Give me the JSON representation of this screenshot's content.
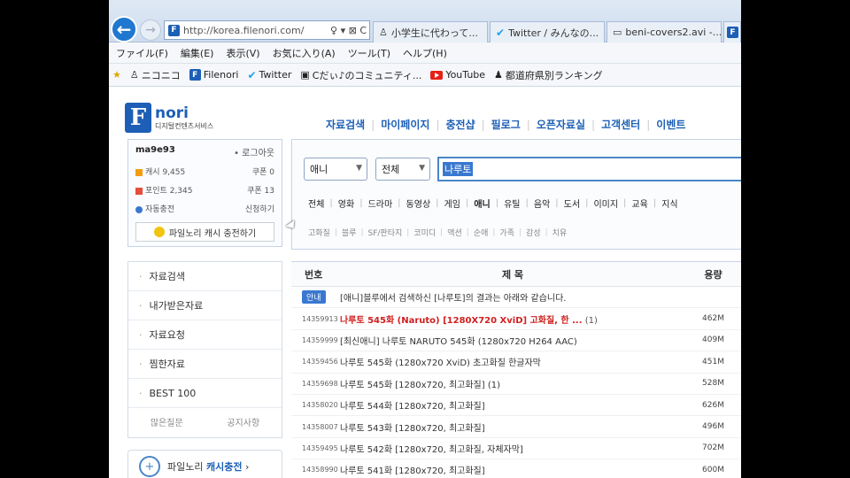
{
  "browser": {
    "address_url": "http://korea.filenori.com/",
    "address_controls": "♀ ▾ ⊠ C",
    "tabs": [
      {
        "label": "小学生に代わって..."
      },
      {
        "label": "Twitter / みんなの..."
      },
      {
        "label": "beni-covers2.avi -..."
      },
      {
        "label": ""
      }
    ],
    "menu": [
      "ファイル(F)",
      "編集(E)",
      "表示(V)",
      "お気に入り(A)",
      "ツール(T)",
      "ヘルプ(H)"
    ],
    "favorites": [
      "ニコニコ",
      "Filenori",
      "Twitter",
      "Cだぃ♪のコミュニティ...",
      "YouTube",
      "都道府県別ランキング"
    ]
  },
  "site": {
    "logo_brand": "nori",
    "logo_subtitle": "디지털컨텐츠서비스",
    "topnav": [
      "자료검색",
      "마이페이지",
      "충전샵",
      "필로그",
      "오픈자료실",
      "고객센터",
      "이벤트"
    ]
  },
  "login": {
    "user_id": "ma9e93",
    "logout": "• 로그아웃",
    "stats": [
      {
        "label": "캐시",
        "value": "9,455",
        "label2": "쿠폰",
        "value2": "0"
      },
      {
        "label": "포인트",
        "value": "2,345",
        "label2": "쿠폰",
        "value2": "13"
      }
    ],
    "auto_label": "자동충전",
    "auto_value": "신청하기",
    "cash_button": "파일노리 캐시 충전하기"
  },
  "search": {
    "category_select": "애니",
    "scope_select": "전체",
    "query": "나루토",
    "categories": [
      "전체",
      "영화",
      "드라마",
      "동영상",
      "게임",
      "애니",
      "유틸",
      "음악",
      "도서",
      "이미지",
      "교육",
      "지식"
    ],
    "active_category": "애니",
    "subcategories": [
      "고화질",
      "블루",
      "SF/판타지",
      "코미디",
      "액션",
      "순애",
      "가족",
      "감성",
      "치유"
    ]
  },
  "sidebar": {
    "items": [
      "자료검색",
      "내가받은자료",
      "자료요청",
      "찜한자료",
      "BEST 100"
    ],
    "footer": [
      "많은질문",
      "공지사항"
    ],
    "charge_label": "파일노리 ",
    "charge_bold": "캐시충전"
  },
  "table": {
    "headers": {
      "num": "번호",
      "title": "제 목",
      "size": "용량"
    },
    "notice": {
      "badge": "안내",
      "title": "[애니]블루에서 검색하신 [나루토]의 결과는 아래와 같습니다."
    },
    "rows": [
      {
        "num": "14359913",
        "title": "나루토 545화 (Naruto) [1280X720 XviD] 고화질, 한 ...",
        "extra": "(1)",
        "size": "462M",
        "hot": true
      },
      {
        "num": "14359999",
        "title": "[최신애니] 나루토 NARUTO 545화 (1280x720 H264 AAC)",
        "extra": "",
        "size": "409M",
        "hot": false
      },
      {
        "num": "14359456",
        "title": "나루토 545화 (1280x720 XviD) 초고화질 한글자막",
        "extra": "",
        "size": "451M",
        "hot": false
      },
      {
        "num": "14359698",
        "title": "나루토 545화 [1280x720, 최고화질]",
        "extra": "(1)",
        "size": "528M",
        "hot": false
      },
      {
        "num": "14358020",
        "title": "나루토 544화 [1280x720, 최고화질]",
        "extra": "",
        "size": "626M",
        "hot": false
      },
      {
        "num": "14358007",
        "title": "나루토 543화 [1280x720, 최고화질]",
        "extra": "",
        "size": "496M",
        "hot": false
      },
      {
        "num": "14359495",
        "title": "나루토 542화 [1280x720, 최고화질, 자체자막]",
        "extra": "",
        "size": "702M",
        "hot": false
      },
      {
        "num": "14358990",
        "title": "나루토 541화 [1280x720, 최고화질]",
        "extra": "",
        "size": "600M",
        "hot": false
      }
    ]
  }
}
